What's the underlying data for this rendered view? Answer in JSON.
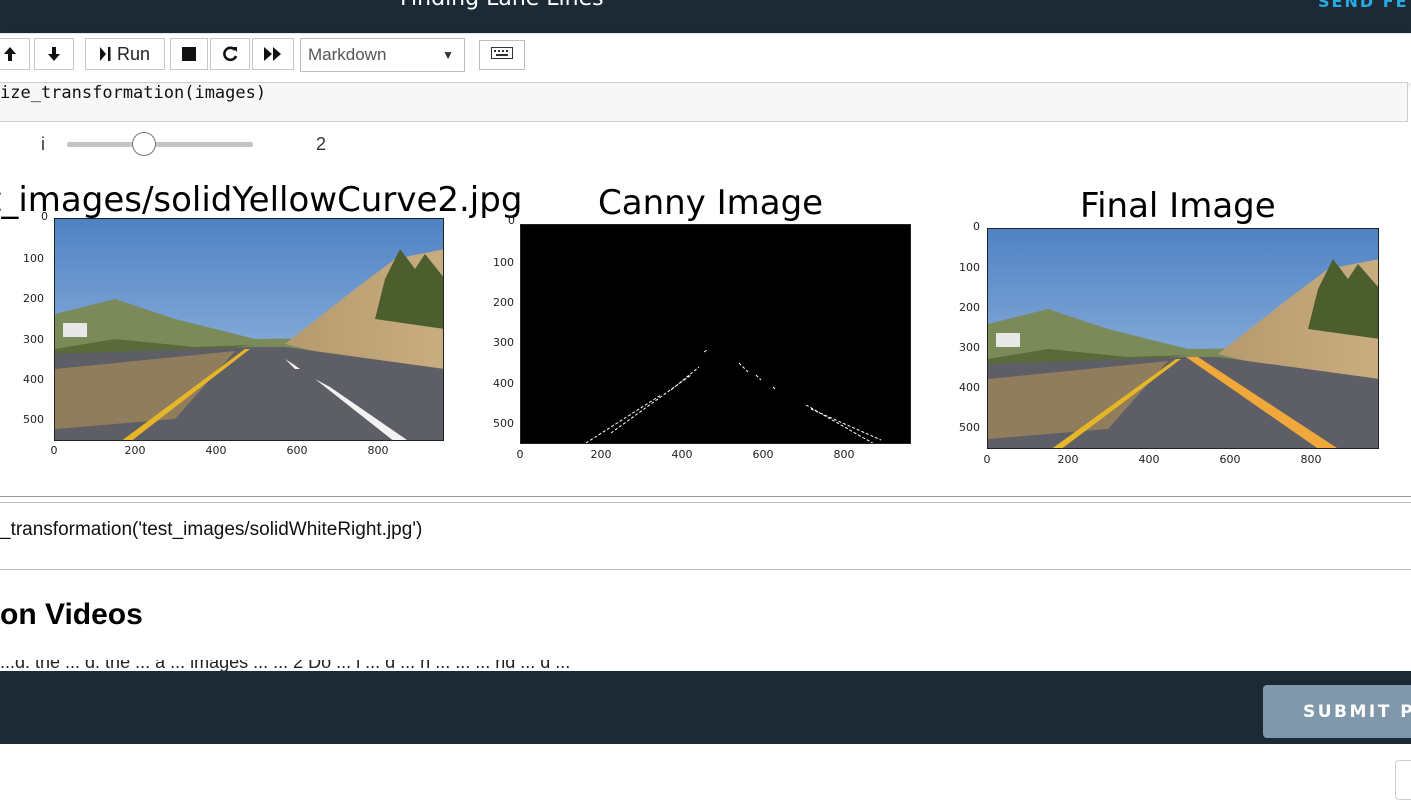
{
  "header": {
    "title": "Finding Lane Lines",
    "send_feedback": "SEND FE"
  },
  "toolbar": {
    "run_label": "Run",
    "cell_type": "Markdown",
    "icons": [
      "arrow-up-icon",
      "arrow-down-icon",
      "run-icon",
      "stop-icon",
      "restart-icon",
      "fast-forward-icon",
      "chevron-down-icon",
      "keyboard-icon"
    ]
  },
  "code": {
    "line1": "ize_transformation(images)",
    "line2": "_transformation('test_images/solidWhiteRight.jpg')"
  },
  "widget": {
    "label": "i",
    "value": "2",
    "level": 2
  },
  "figures": [
    {
      "title": "t_images/solidYellowCurve2.jpg",
      "yticks": [
        "0",
        "100",
        "200",
        "300",
        "400",
        "500"
      ],
      "xticks": [
        "0",
        "200",
        "400",
        "600",
        "800"
      ]
    },
    {
      "title": "Canny Image",
      "yticks": [
        "0",
        "100",
        "200",
        "300",
        "400",
        "500"
      ],
      "xticks": [
        "0",
        "200",
        "400",
        "600",
        "800"
      ]
    },
    {
      "title": "Final Image",
      "yticks": [
        "0",
        "100",
        "200",
        "300",
        "400",
        "500"
      ],
      "xticks": [
        "0",
        "200",
        "400",
        "600",
        "800"
      ]
    }
  ],
  "content": {
    "heading": "on Videos",
    "cutoff_text": "...d. the ... d. the ... a ... images ... ... 2 Do ... i ... d ... h ... ... ... rid ... d ..."
  },
  "footer": {
    "submit_label": "SUBMIT P"
  },
  "colors": {
    "dark_bar": "#1c2a35",
    "accent_blue": "#2aa8e0",
    "submit_bg": "#7f98aa"
  }
}
